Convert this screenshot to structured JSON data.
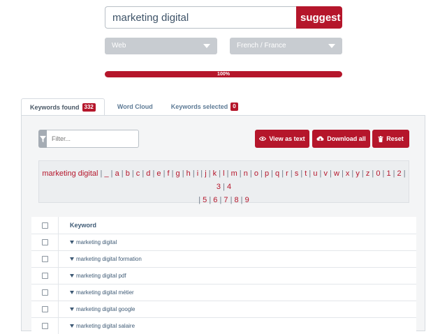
{
  "search": {
    "value": "marketing digital",
    "button_label": "suggest"
  },
  "selects": {
    "engine": "Web",
    "language": "French / France"
  },
  "progress": {
    "percent": 100,
    "label": "100%"
  },
  "tabs": [
    {
      "label": "Keywords found",
      "badge": "332"
    },
    {
      "label": "Word Cloud"
    },
    {
      "label": "Keywords selected",
      "badge": "0"
    }
  ],
  "toolbar": {
    "filter_placeholder": "Filter...",
    "view_as_text": "View as text",
    "download_all": "Download all",
    "reset": "Reset"
  },
  "alphabet": {
    "root": "marketing digital",
    "letters_line1": [
      "_",
      "a",
      "b",
      "c",
      "d",
      "e",
      "f",
      "g",
      "h",
      "i",
      "j",
      "k",
      "l",
      "m",
      "n",
      "o",
      "p",
      "q",
      "r",
      "s",
      "t",
      "u",
      "v",
      "w",
      "x",
      "y",
      "z",
      "0",
      "1",
      "2",
      "3",
      "4"
    ],
    "letters_line2": [
      "5",
      "6",
      "7",
      "8",
      "9"
    ]
  },
  "table": {
    "header": "Keyword",
    "rows": [
      "marketing digital",
      "marketing digital formation",
      "marketing digital pdf",
      "marketing digital métier",
      "marketing digital google",
      "marketing digital salaire"
    ]
  },
  "colors": {
    "accent": "#b5162b",
    "select_bg": "#c8ccd1",
    "link": "#3e5a75"
  }
}
